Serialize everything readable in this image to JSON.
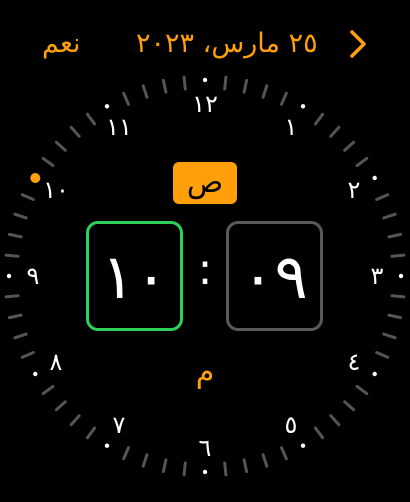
{
  "header": {
    "confirm_label": "نعم",
    "date_label": "٢٥ مارس، ٢٠٢٣"
  },
  "clock": {
    "dial_numbers": [
      "١٢",
      "١",
      "٢",
      "٣",
      "٤",
      "٥",
      "٦",
      "٧",
      "٨",
      "٩",
      "١٠",
      "١١"
    ],
    "hour_value": "١٠",
    "minute_value": "٠٩",
    "separator": ":",
    "am_label": "ص",
    "pm_label": "م",
    "selected_hour_index": 10
  },
  "colors": {
    "accent": "#ff9f0a",
    "selected_border": "#30d158",
    "inactive_border": "#5a5a5a",
    "tick": "#555555",
    "hour_dot": "#ffffff"
  }
}
